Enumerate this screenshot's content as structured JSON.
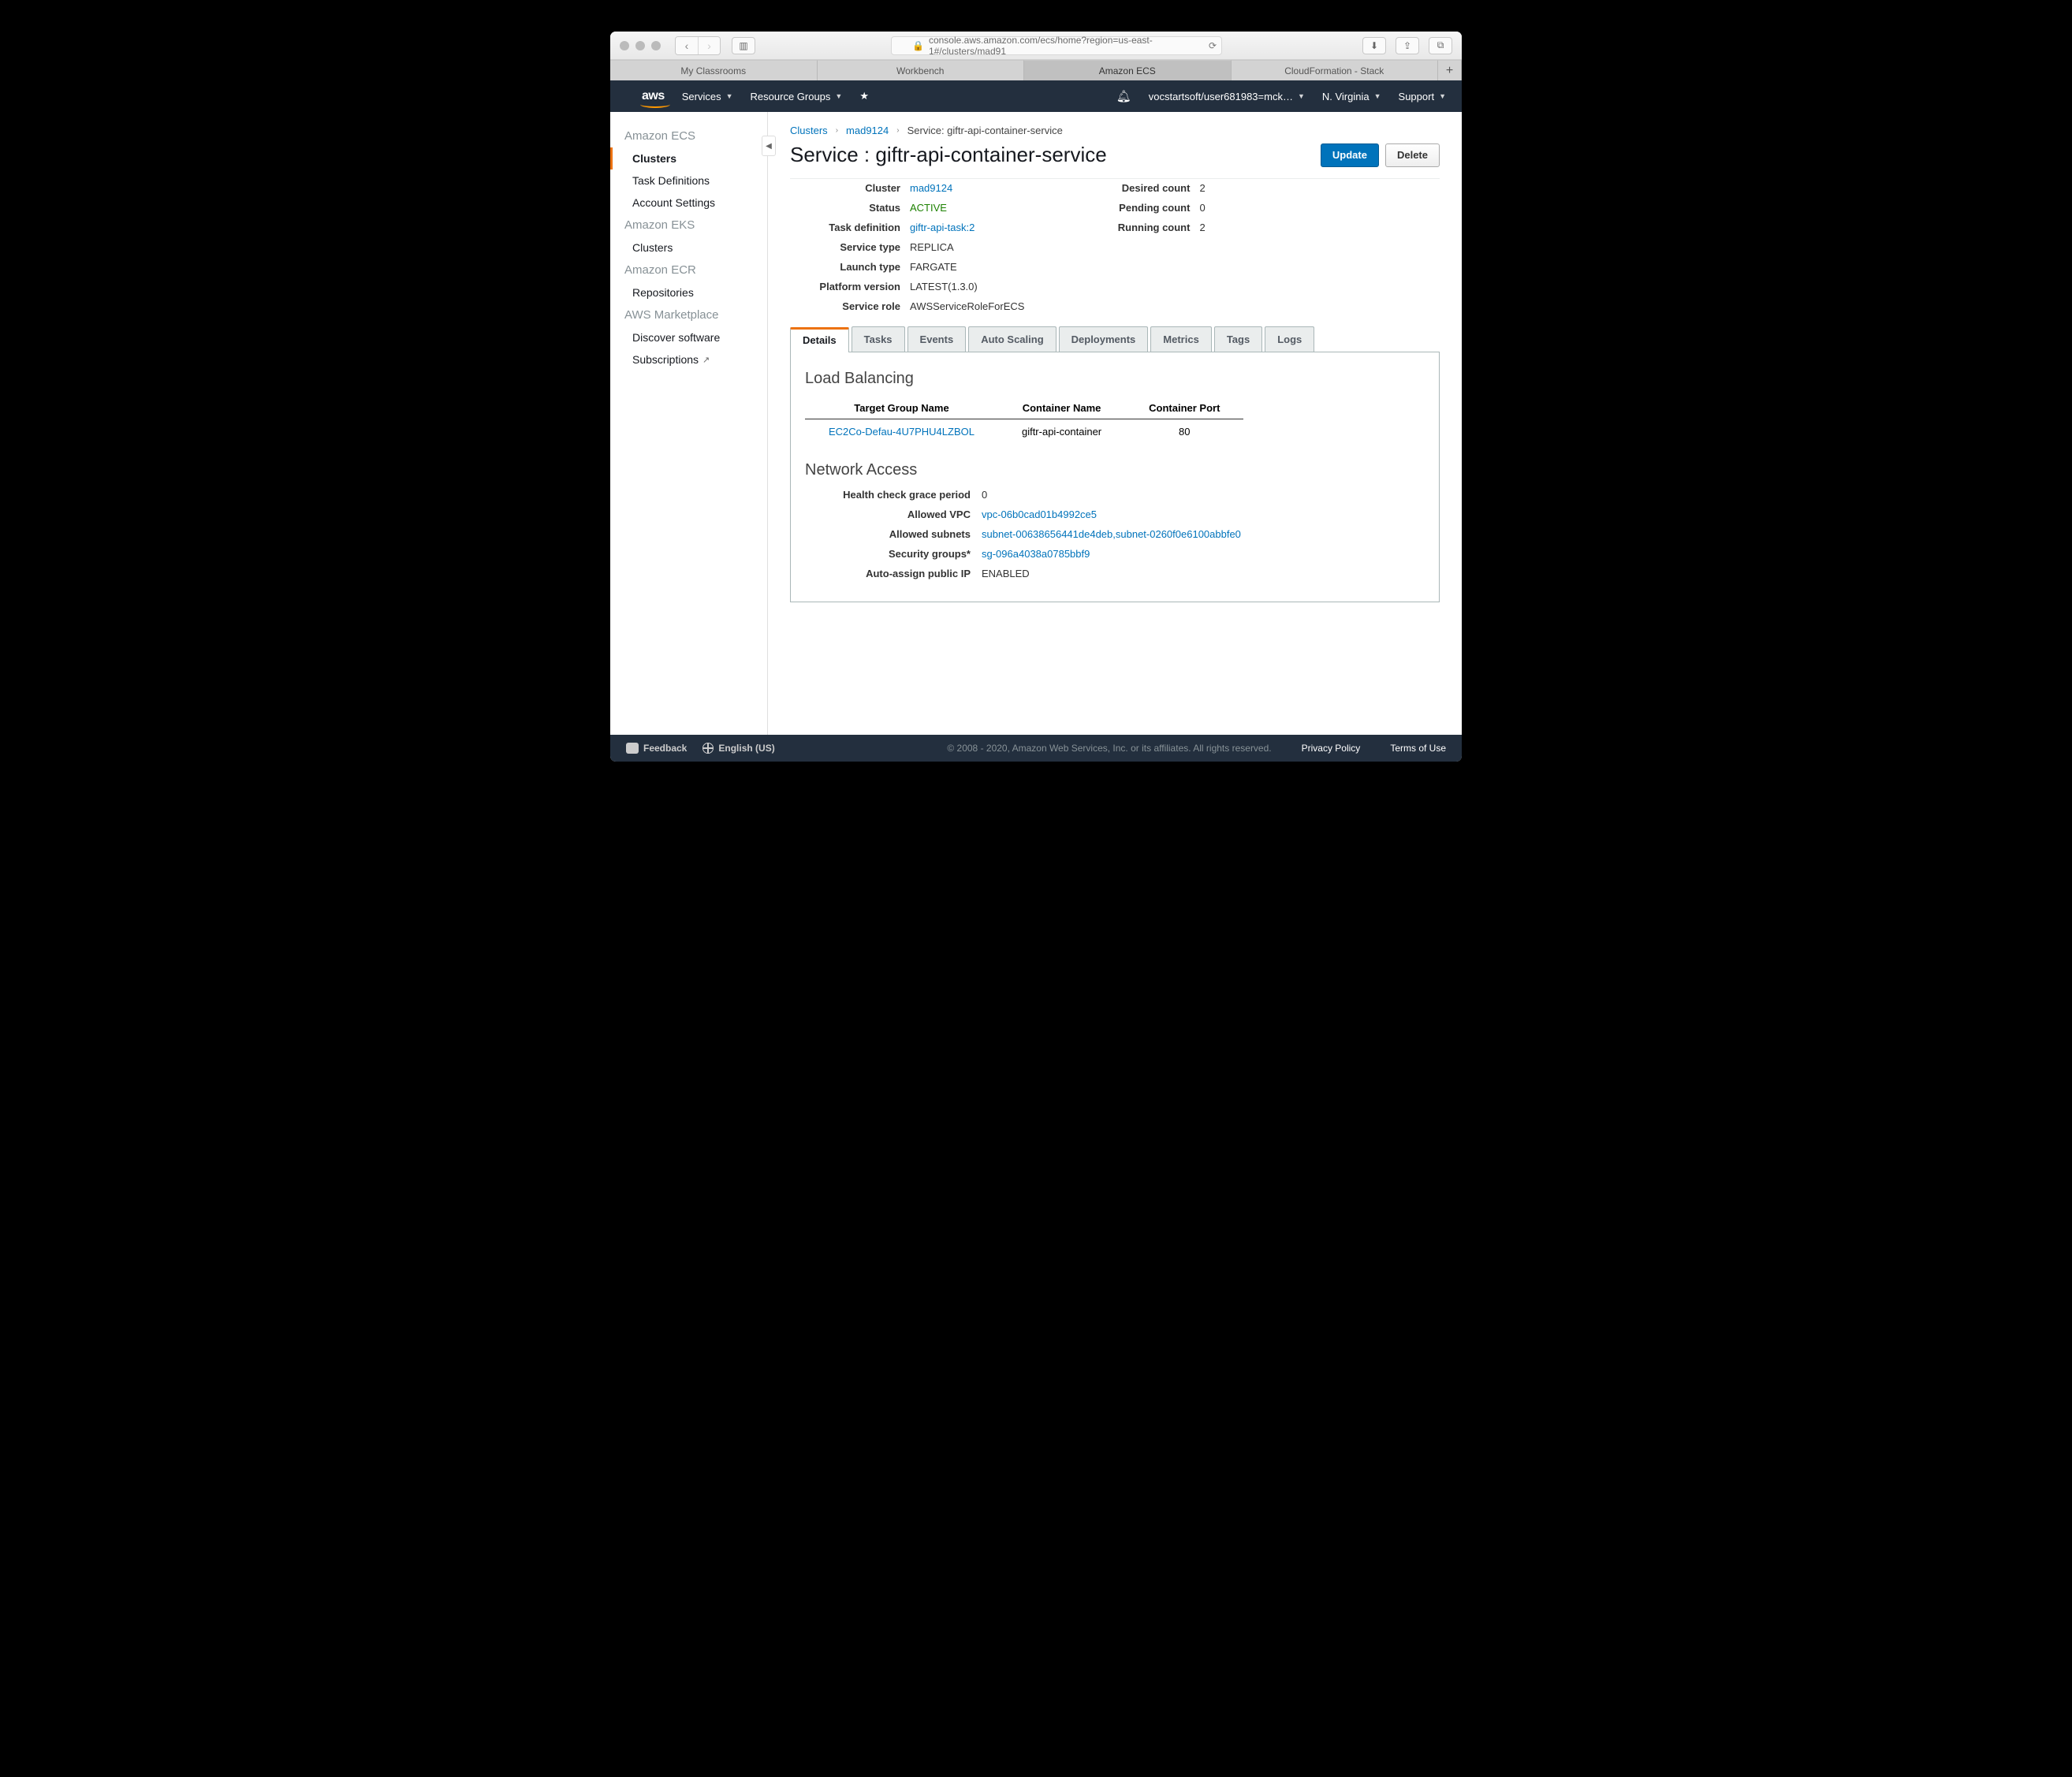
{
  "browser": {
    "url": "console.aws.amazon.com/ecs/home?region=us-east-1#/clusters/mad91",
    "tabs": [
      "My Classrooms",
      "Workbench",
      "Amazon ECS",
      "CloudFormation - Stack"
    ],
    "active_tab": 2
  },
  "aws_nav": {
    "logo": "aws",
    "services": "Services",
    "resource_groups": "Resource Groups",
    "user": "vocstartsoft/user681983=mck…",
    "region": "N. Virginia",
    "support": "Support"
  },
  "sidebar": {
    "groups": [
      {
        "head": "Amazon ECS",
        "items": [
          {
            "label": "Clusters",
            "active": true
          },
          {
            "label": "Task Definitions"
          },
          {
            "label": "Account Settings"
          }
        ]
      },
      {
        "head": "Amazon EKS",
        "items": [
          {
            "label": "Clusters"
          }
        ]
      },
      {
        "head": "Amazon ECR",
        "items": [
          {
            "label": "Repositories"
          }
        ]
      },
      {
        "head": "AWS Marketplace",
        "items": [
          {
            "label": "Discover software"
          },
          {
            "label": "Subscriptions",
            "ext": true
          }
        ]
      }
    ]
  },
  "breadcrumbs": {
    "root": "Clusters",
    "cluster": "mad9124",
    "current": "Service: giftr-api-container-service"
  },
  "page": {
    "title": "Service : giftr-api-container-service",
    "update": "Update",
    "delete": "Delete"
  },
  "summary_left": {
    "cluster_lbl": "Cluster",
    "cluster": "mad9124",
    "status_lbl": "Status",
    "status": "ACTIVE",
    "taskdef_lbl": "Task definition",
    "taskdef": "giftr-api-task:2",
    "servicetype_lbl": "Service type",
    "servicetype": "REPLICA",
    "launchtype_lbl": "Launch type",
    "launchtype": "FARGATE",
    "platform_lbl": "Platform version",
    "platform": "LATEST(1.3.0)",
    "role_lbl": "Service role",
    "role": "AWSServiceRoleForECS"
  },
  "summary_right": {
    "desired_lbl": "Desired count",
    "desired": "2",
    "pending_lbl": "Pending count",
    "pending": "0",
    "running_lbl": "Running count",
    "running": "2"
  },
  "tabs": [
    "Details",
    "Tasks",
    "Events",
    "Auto Scaling",
    "Deployments",
    "Metrics",
    "Tags",
    "Logs"
  ],
  "load_balancing": {
    "heading": "Load Balancing",
    "cols": {
      "tg": "Target Group Name",
      "cn": "Container Name",
      "cp": "Container Port"
    },
    "row": {
      "tg": "EC2Co-Defau-4U7PHU4LZBOL",
      "cn": "giftr-api-container",
      "cp": "80"
    }
  },
  "network": {
    "heading": "Network Access",
    "grace_lbl": "Health check grace period",
    "grace": "0",
    "vpc_lbl": "Allowed VPC",
    "vpc": "vpc-06b0cad01b4992ce5",
    "subnets_lbl": "Allowed subnets",
    "subnets": "subnet-00638656441de4deb,subnet-0260f0e6100abbfe0",
    "sg_lbl": "Security groups*",
    "sg": "sg-096a4038a0785bbf9",
    "autoip_lbl": "Auto-assign public IP",
    "autoip": "ENABLED"
  },
  "footer": {
    "feedback": "Feedback",
    "language": "English (US)",
    "copyright": "© 2008 - 2020, Amazon Web Services, Inc. or its affiliates. All rights reserved.",
    "privacy": "Privacy Policy",
    "terms": "Terms of Use"
  }
}
